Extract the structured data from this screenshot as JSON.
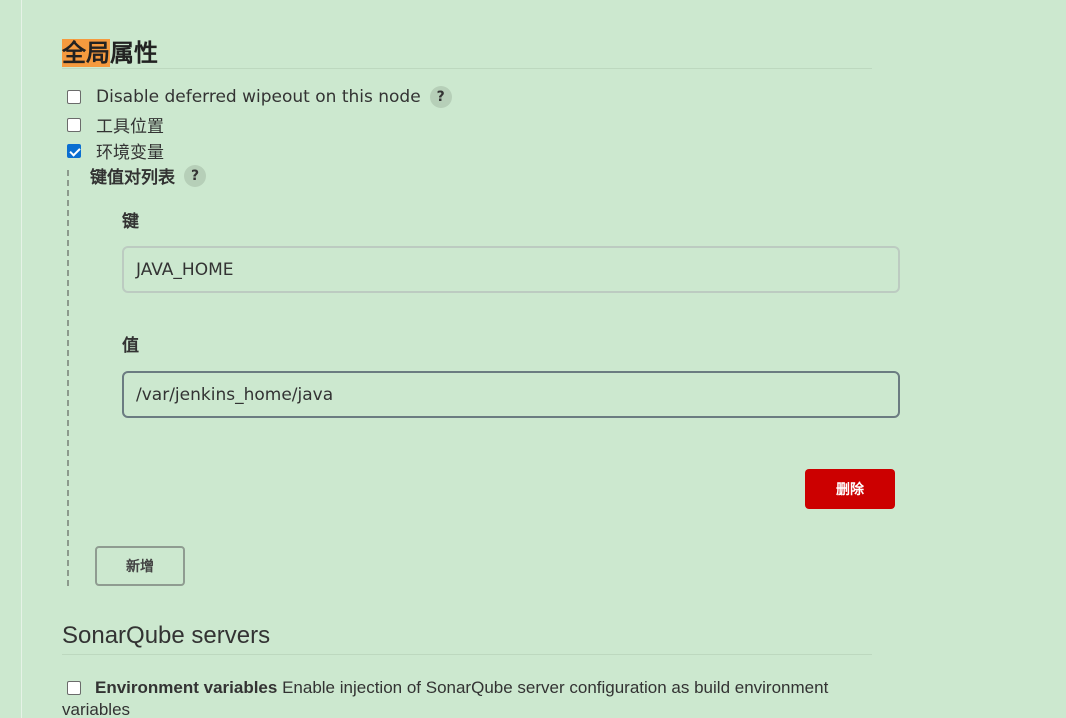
{
  "global_properties": {
    "title_highlight": "全局",
    "title_rest": "属性",
    "options": [
      {
        "label": "Disable deferred wipeout on this node",
        "checked": false,
        "help": "?"
      },
      {
        "label": "工具位置",
        "checked": false
      },
      {
        "label": "环境变量",
        "checked": true
      }
    ],
    "kv_list": {
      "label": "键值对列表",
      "help": "?",
      "key_label": "键",
      "key_value": "JAVA_HOME",
      "value_label": "值",
      "value_value": "/var/jenkins_home/java",
      "delete_label": "删除",
      "add_label": "新增"
    }
  },
  "sonarqube": {
    "title": "SonarQube servers",
    "env_checkbox_checked": false,
    "env_label": "Environment variables",
    "env_desc": "Enable injection of SonarQube server configuration as build environment",
    "env_desc_wrap": "variables"
  },
  "colors": {
    "background": "#cce8cf",
    "delete_button": "#cc0000",
    "checkbox_checked": "#0a6ed1",
    "title_highlight": "#f59a3e"
  }
}
